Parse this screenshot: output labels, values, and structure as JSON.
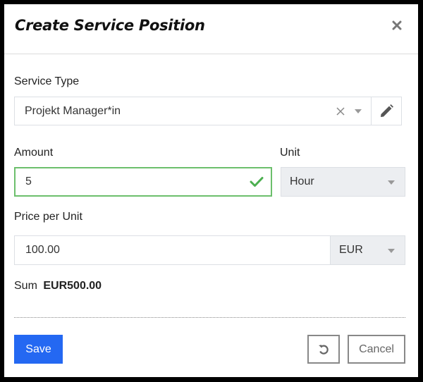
{
  "dialog": {
    "title": "Create Service Position",
    "close_icon": "close-icon"
  },
  "service_type": {
    "label": "Service Type",
    "value": "Projekt Manager*in",
    "clear_icon": "clear-icon",
    "dropdown_icon": "chevron-down-icon",
    "edit_icon": "pencil-icon"
  },
  "amount": {
    "label": "Amount",
    "value": "5",
    "status": "valid",
    "status_icon": "check-icon",
    "valid_color": "#4caf50"
  },
  "unit": {
    "label": "Unit",
    "value": "Hour",
    "disabled": true
  },
  "price": {
    "label": "Price per Unit",
    "value": "100.00",
    "currency": "EUR"
  },
  "sum": {
    "label": "Sum",
    "value": "EUR500.00"
  },
  "footer": {
    "save_label": "Save",
    "reset_icon": "reset-icon",
    "cancel_label": "Cancel"
  },
  "colors": {
    "primary": "#2468f2",
    "valid": "#4caf50"
  }
}
